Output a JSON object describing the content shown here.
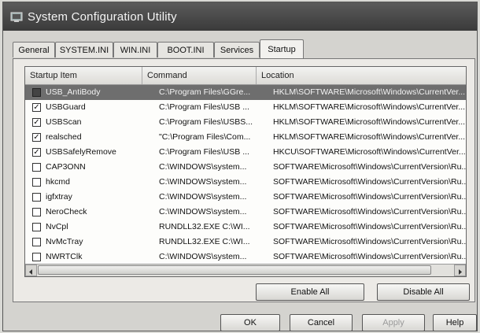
{
  "window": {
    "title": "System Configuration Utility",
    "icon": "system-config-icon"
  },
  "tabs": [
    {
      "label": "General",
      "active": false
    },
    {
      "label": "SYSTEM.INI",
      "active": false
    },
    {
      "label": "WIN.INI",
      "active": false
    },
    {
      "label": "BOOT.INI",
      "active": false
    },
    {
      "label": "Services",
      "active": false
    },
    {
      "label": "Startup",
      "active": true
    }
  ],
  "list": {
    "columns": [
      "Startup Item",
      "Command",
      "Location"
    ],
    "rows": [
      {
        "name": "USB_AntiBody",
        "command": "C:\\Program Files\\GGre...",
        "location": "HKLM\\SOFTWARE\\Microsoft\\Windows\\CurrentVer...",
        "checked": false,
        "selected": true
      },
      {
        "name": "USBGuard",
        "command": "C:\\Program Files\\USB ...",
        "location": "HKLM\\SOFTWARE\\Microsoft\\Windows\\CurrentVer...",
        "checked": true,
        "selected": false
      },
      {
        "name": "USBScan",
        "command": "C:\\Program Files\\USBS...",
        "location": "HKLM\\SOFTWARE\\Microsoft\\Windows\\CurrentVer...",
        "checked": true,
        "selected": false
      },
      {
        "name": "realsched",
        "command": "\"C:\\Program Files\\Com...",
        "location": "HKLM\\SOFTWARE\\Microsoft\\Windows\\CurrentVer...",
        "checked": true,
        "selected": false
      },
      {
        "name": "USBSafelyRemove",
        "command": "C:\\Program Files\\USB ...",
        "location": "HKCU\\SOFTWARE\\Microsoft\\Windows\\CurrentVer...",
        "checked": true,
        "selected": false
      },
      {
        "name": "CAP3ONN",
        "command": "C:\\WINDOWS\\system...",
        "location": "SOFTWARE\\Microsoft\\Windows\\CurrentVersion\\Ru...",
        "checked": false,
        "selected": false
      },
      {
        "name": "hkcmd",
        "command": "C:\\WINDOWS\\system...",
        "location": "SOFTWARE\\Microsoft\\Windows\\CurrentVersion\\Ru...",
        "checked": false,
        "selected": false
      },
      {
        "name": "igfxtray",
        "command": "C:\\WINDOWS\\system...",
        "location": "SOFTWARE\\Microsoft\\Windows\\CurrentVersion\\Ru...",
        "checked": false,
        "selected": false
      },
      {
        "name": "NeroCheck",
        "command": "C:\\WINDOWS\\system...",
        "location": "SOFTWARE\\Microsoft\\Windows\\CurrentVersion\\Ru...",
        "checked": false,
        "selected": false
      },
      {
        "name": "NvCpl",
        "command": "RUNDLL32.EXE C:\\WI...",
        "location": "SOFTWARE\\Microsoft\\Windows\\CurrentVersion\\Ru...",
        "checked": false,
        "selected": false
      },
      {
        "name": "NvMcTray",
        "command": "RUNDLL32.EXE C:\\WI...",
        "location": "SOFTWARE\\Microsoft\\Windows\\CurrentVersion\\Ru...",
        "checked": false,
        "selected": false
      },
      {
        "name": "NWRTClk",
        "command": "C:\\WINDOWS\\system...",
        "location": "SOFTWARE\\Microsoft\\Windows\\CurrentVersion\\Ru...",
        "checked": false,
        "selected": false
      }
    ]
  },
  "buttons": {
    "enable_all": "Enable All",
    "disable_all": "Disable All",
    "ok": "OK",
    "cancel": "Cancel",
    "apply": "Apply",
    "help": "Help"
  }
}
